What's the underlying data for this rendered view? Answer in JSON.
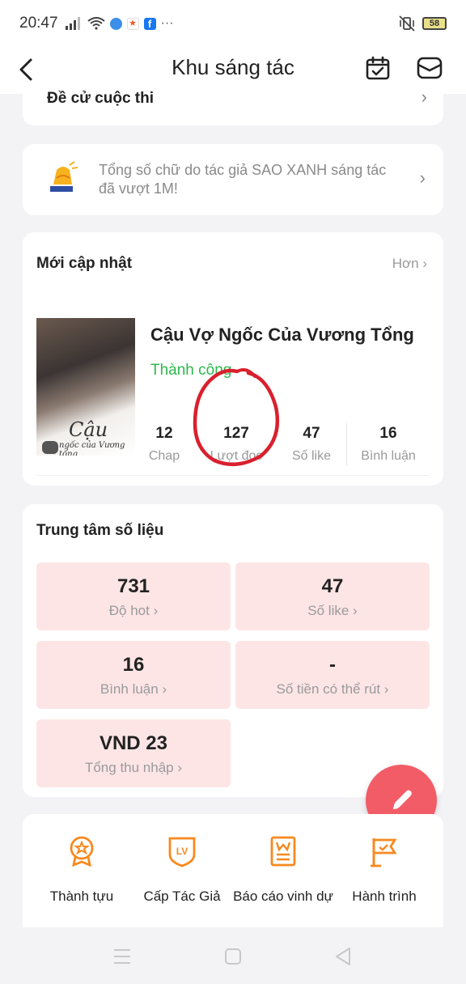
{
  "status_bar": {
    "time": "20:47",
    "more": "···",
    "battery": "58"
  },
  "header": {
    "title": "Khu sáng tác"
  },
  "contest": {
    "label": "Đề cử cuộc thi"
  },
  "notice": {
    "text": "Tổng số chữ do tác giả SAO XANH sáng tác đã vượt 1M!"
  },
  "recent": {
    "title": "Mới cập nhật",
    "more": "Hơn",
    "story": {
      "title": "Cậu Vợ Ngốc Của Vương Tổng",
      "status": "Thành công",
      "cover_title": "Cậu",
      "cover_subtitle": "ngốc của Vương tổng",
      "stats": [
        {
          "value": "12",
          "label": "Chap"
        },
        {
          "value": "127",
          "label": "Lượt đọc"
        },
        {
          "value": "47",
          "label": "Số like"
        },
        {
          "value": "16",
          "label": "Bình luận"
        }
      ]
    }
  },
  "data_center": {
    "title": "Trung tâm số liệu",
    "tiles": [
      {
        "value": "731",
        "label": "Độ hot"
      },
      {
        "value": "47",
        "label": "Số like"
      },
      {
        "value": "16",
        "label": "Bình luận"
      },
      {
        "value": "-",
        "label": "Số tiền có thể rút"
      },
      {
        "value": "VND 23",
        "label": "Tổng thu nhập"
      }
    ]
  },
  "achievements": {
    "items": [
      {
        "label": "Thành tựu",
        "icon": "medal-icon"
      },
      {
        "label": "Cấp Tác Giả",
        "icon": "level-badge-icon"
      },
      {
        "label": "Báo cáo vinh dự",
        "icon": "honor-report-icon"
      },
      {
        "label": "Hành trình",
        "icon": "journey-flag-icon"
      }
    ]
  },
  "colors": {
    "accent": "#f7891f",
    "success": "#2db84d",
    "tile_bg": "#fde5e6",
    "fab": "#f25c67",
    "annotation": "#d9202e"
  }
}
